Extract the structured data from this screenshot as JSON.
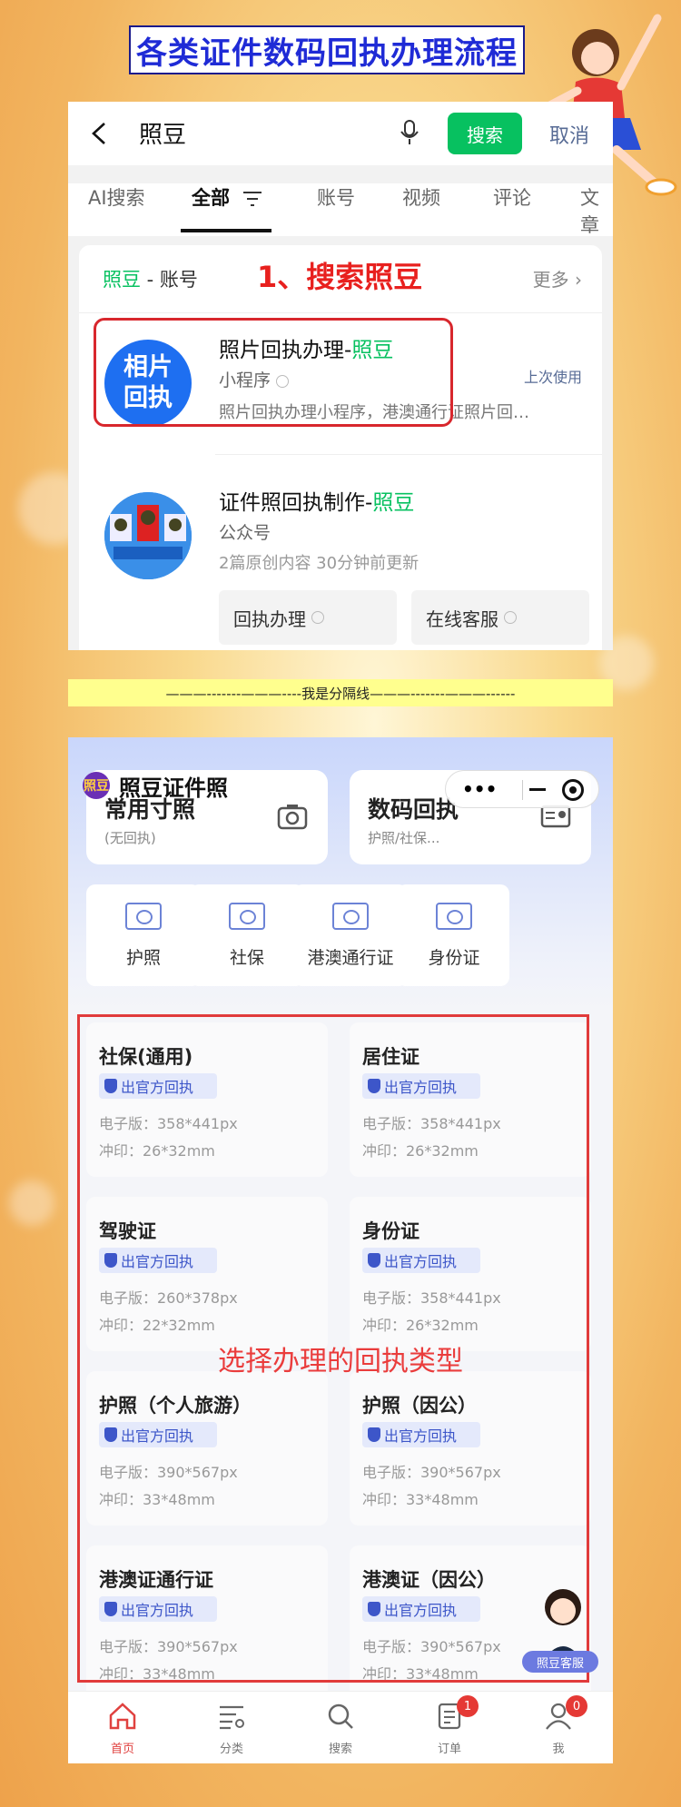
{
  "header": {
    "title": "各类证件数码回执办理流程"
  },
  "search": {
    "query": "照豆",
    "search_button": "搜索",
    "cancel": "取消",
    "tabs": [
      "AI搜索",
      "全部",
      "账号",
      "视频",
      "评论",
      "文章"
    ],
    "section_title_hl": "照豆",
    "section_title_rest": " - 账号",
    "step_label": "1、搜索照豆",
    "more": "更多",
    "results": [
      {
        "avatar_text": "相片\n回执",
        "title": "照片回执办理-",
        "title_hl": "照豆",
        "type": "小程序",
        "desc": "照片回执办理小程序，港澳通行证照片回…",
        "badge": "上次使用"
      },
      {
        "title": "证件照回执制作-",
        "title_hl": "照豆",
        "type": "公众号",
        "meta": "2篇原创内容   30分钟前更新",
        "buttons": [
          "回执办理",
          "在线客服"
        ]
      }
    ]
  },
  "separator": "———-------———----我是分隔线———-------———------",
  "miniapp": {
    "logo": "照豆",
    "name": "照豆证件照",
    "cards": [
      {
        "title": "常用寸照",
        "sub": "(无回执)"
      },
      {
        "title": "数码回执",
        "sub": "护照/社保..."
      }
    ],
    "types": [
      "护照",
      "社保",
      "港澳通行证",
      "身份证"
    ],
    "badge_label": "出官方回执",
    "certs": [
      {
        "name": "社保(通用)",
        "elec": "电子版：358*441px",
        "print": "冲印：26*32mm"
      },
      {
        "name": "居住证",
        "elec": "电子版：358*441px",
        "print": "冲印：26*32mm"
      },
      {
        "name": "驾驶证",
        "elec": "电子版：260*378px",
        "print": "冲印：22*32mm"
      },
      {
        "name": "身份证",
        "elec": "电子版：358*441px",
        "print": "冲印：26*32mm"
      },
      {
        "name": "护照（个人旅游）",
        "elec": "电子版：390*567px",
        "print": "冲印：33*48mm"
      },
      {
        "name": "护照（因公）",
        "elec": "电子版：390*567px",
        "print": "冲印：33*48mm"
      },
      {
        "name": "港澳证通行证",
        "elec": "电子版：390*567px",
        "print": "冲印：33*48mm"
      },
      {
        "name": "港澳证（因公）",
        "elec": "电子版：390*567px",
        "print": "冲印：33*48mm"
      }
    ],
    "step_label": "选择办理的回执类型",
    "customer_service": "照豆客服",
    "tabbar": [
      {
        "label": "首页",
        "badge": ""
      },
      {
        "label": "分类",
        "badge": ""
      },
      {
        "label": "搜索",
        "badge": ""
      },
      {
        "label": "订单",
        "badge": "1"
      },
      {
        "label": "我",
        "badge": "0"
      }
    ],
    "accent": "#e0413f"
  }
}
